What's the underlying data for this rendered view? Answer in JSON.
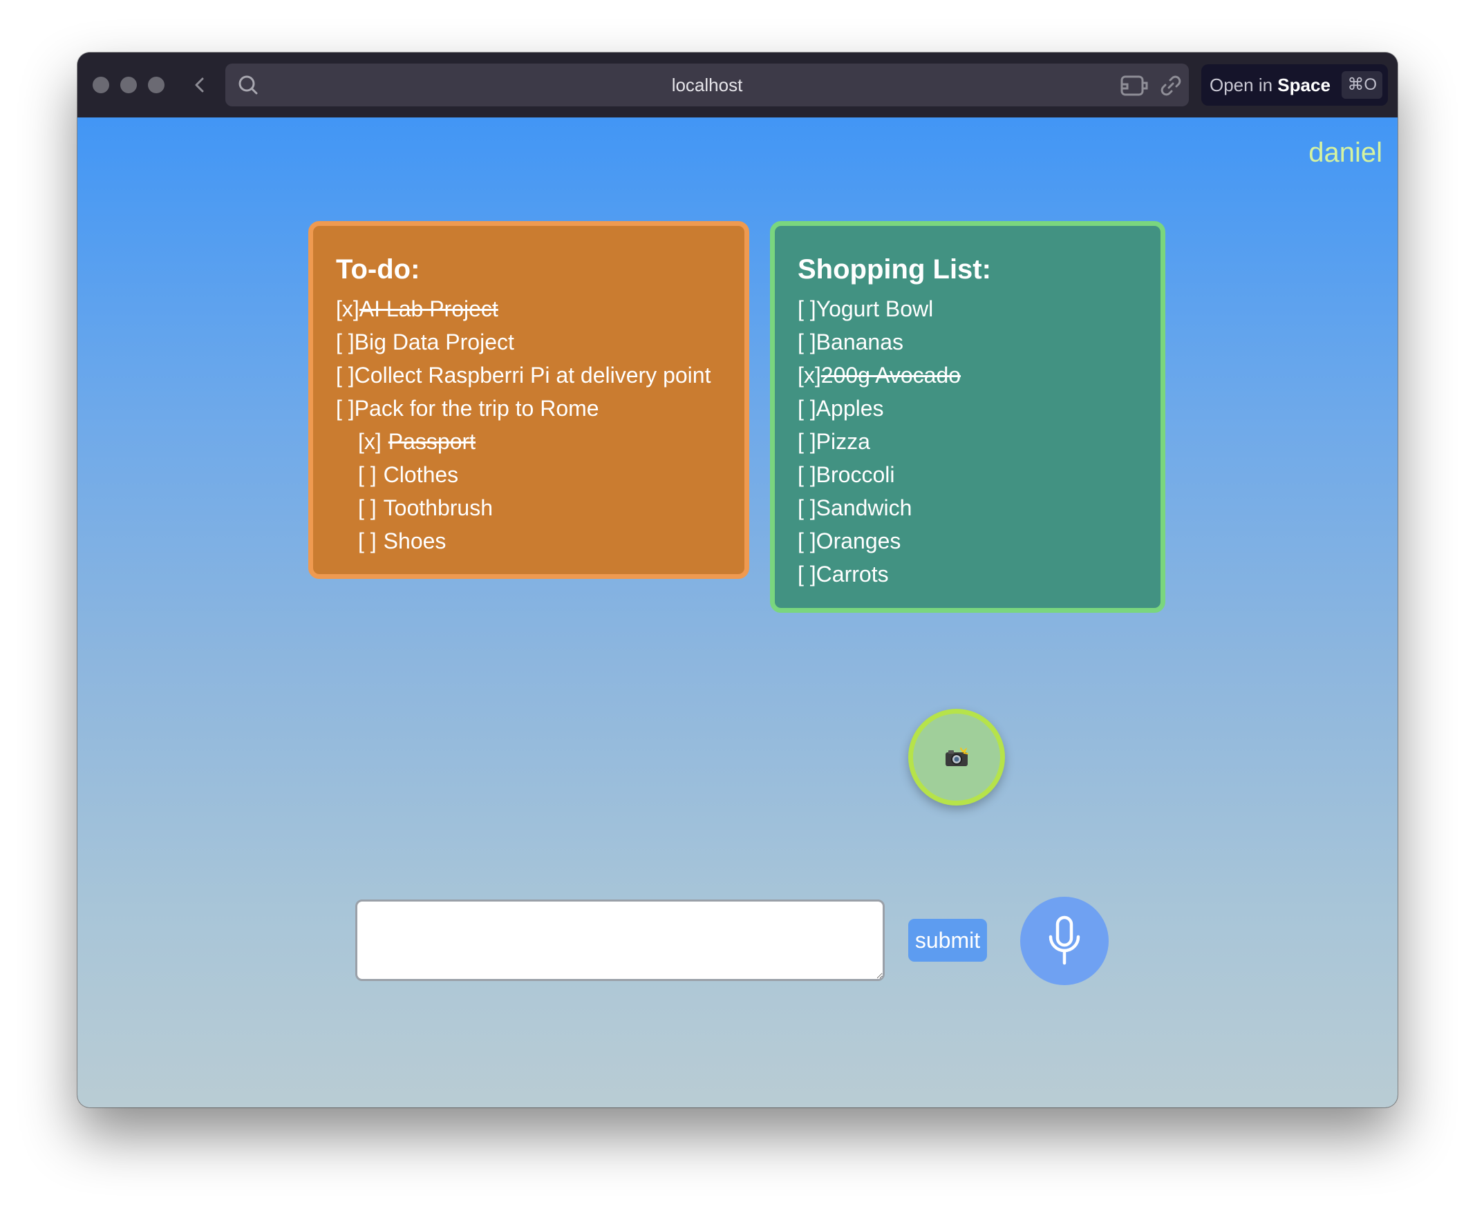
{
  "browser": {
    "url": "localhost",
    "open_in_prefix": "Open in ",
    "open_in_target": "Space",
    "shortcut": "⌘O"
  },
  "user": {
    "name": "daniel"
  },
  "todo": {
    "title": "To-do:",
    "items": [
      {
        "mark": "[x]",
        "text": "AI Lab Project",
        "done": true
      },
      {
        "mark": "[ ]",
        "text": "Big Data Project",
        "done": false
      },
      {
        "mark": "[ ]",
        "text": "Collect Raspberri Pi at delivery point",
        "done": false
      },
      {
        "mark": "[ ]",
        "text": "Pack for the trip to Rome",
        "done": false
      },
      {
        "mark": "[x]",
        "text": "Passport",
        "done": true
      },
      {
        "mark": "[ ]",
        "text": "Clothes",
        "done": false
      },
      {
        "mark": "[ ]",
        "text": "Toothbrush",
        "done": false
      },
      {
        "mark": "[ ]",
        "text": "Shoes",
        "done": false
      }
    ]
  },
  "shopping": {
    "title": "Shopping List:",
    "items": [
      {
        "mark": "[ ]",
        "text": "Yogurt Bowl",
        "done": false
      },
      {
        "mark": "[ ]",
        "text": "Bananas",
        "done": false
      },
      {
        "mark": "[x]",
        "text": "200g Avocado",
        "done": true
      },
      {
        "mark": "[ ]",
        "text": "Apples",
        "done": false
      },
      {
        "mark": "[ ]",
        "text": "Pizza",
        "done": false
      },
      {
        "mark": "[ ]",
        "text": "Broccoli",
        "done": false
      },
      {
        "mark": "[ ]",
        "text": "Sandwich",
        "done": false
      },
      {
        "mark": "[ ]",
        "text": "Oranges",
        "done": false
      },
      {
        "mark": "[ ]",
        "text": "Carrots",
        "done": false
      }
    ]
  },
  "input": {
    "value": "",
    "placeholder": ""
  },
  "actions": {
    "submit_label": "submit",
    "camera_icon": "camera-flash-icon",
    "mic_icon": "microphone-icon"
  },
  "colors": {
    "todo_bg": "#ca7c30",
    "todo_border": "#ef9a50",
    "shop_bg": "#429282",
    "shop_border": "#7ad67e",
    "username": "#d6f3a0",
    "accent_button": "#5d9cf0"
  }
}
